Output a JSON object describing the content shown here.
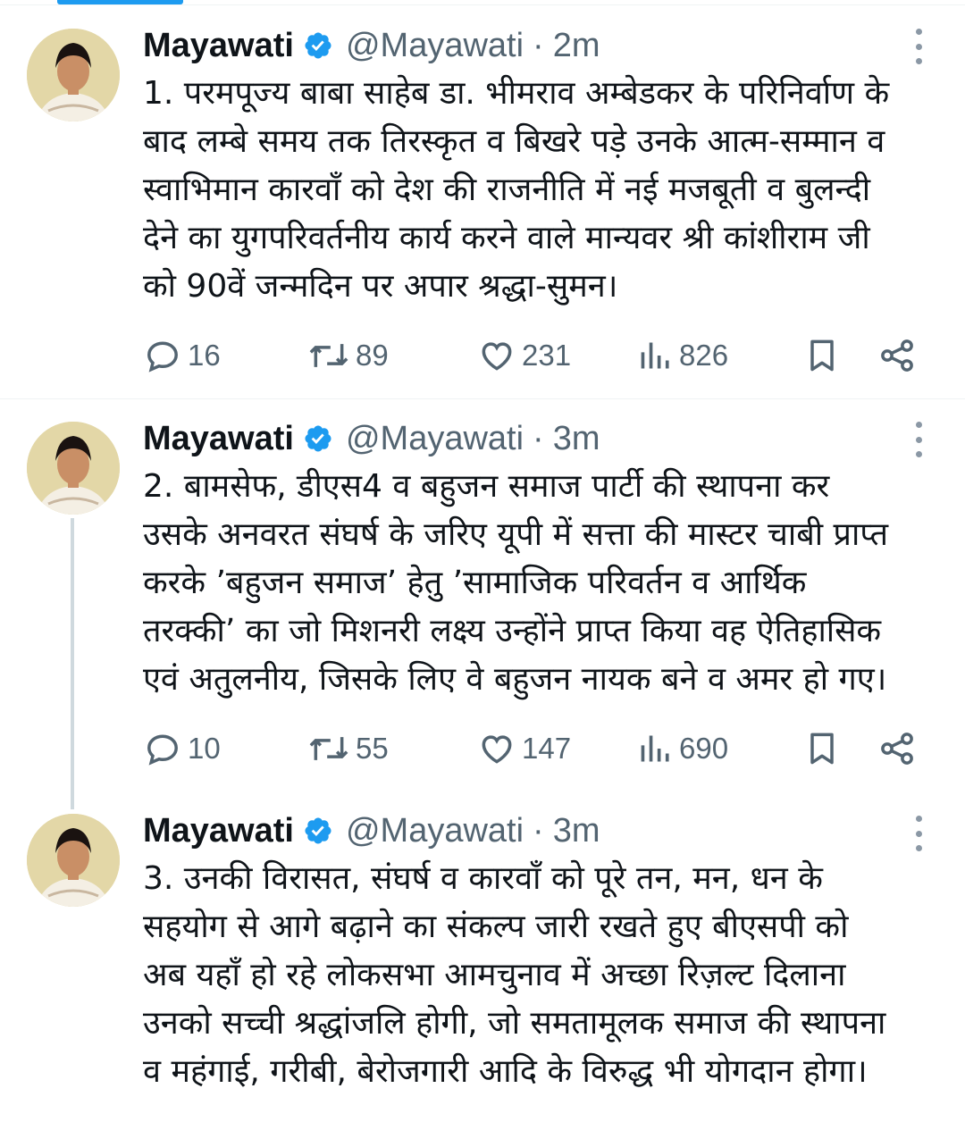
{
  "tweets": [
    {
      "author": {
        "name": "Mayawati",
        "handle": "@Mayawati",
        "verified": true
      },
      "time": "2m",
      "text": "1. परमपूज्य बाबा साहेब डा. भीमराव अम्बेडकर के परिनिर्वाण के\nबाद लम्बे समय तक तिरस्कृत व बिखरे पड़े उनके आत्म-सम्मान व\nस्वाभिमान कारवाँ को देश की राजनीति में नई मजबूती व बुलन्दी\nदेने का युगपरिवर्तनीय कार्य करने वाले मान्यवर श्री कांशीराम जी\nको 90वें जन्मदिन पर अपार श्रद्धा-सुमन।",
      "stats": {
        "replies": "16",
        "reposts": "89",
        "likes": "231",
        "views": "826"
      }
    },
    {
      "author": {
        "name": "Mayawati",
        "handle": "@Mayawati",
        "verified": true
      },
      "time": "3m",
      "text": "2. बामसेफ, डीएस4 व बहुजन समाज पार्टी की स्थापना कर\nउसके अनवरत संघर्ष के जरिए यूपी में सत्ता की मास्टर चाबी प्राप्त\nकरके ’बहुजन समाज’ हेतु ’सामाजिक परिवर्तन व आर्थिक\nतरक्की’ का जो मिशनरी लक्ष्य उन्होंने प्राप्त किया वह ऐतिहासिक\nएवं अतुलनीय, जिसके लिए वे बहुजन नायक बने व अमर हो गए।",
      "stats": {
        "replies": "10",
        "reposts": "55",
        "likes": "147",
        "views": "690"
      }
    },
    {
      "author": {
        "name": "Mayawati",
        "handle": "@Mayawati",
        "verified": true
      },
      "time": "3m",
      "text": "3. उनकी विरासत, संघर्ष व कारवाँ को पूरे तन, मन, धन के\nसहयोग से आगे बढ़ाने का संकल्प जारी रखते हुए बीएसपी को\nअब यहाँ हो रहे लोकसभा आमचुनाव में अच्छा रिज़ल्ट दिलाना\nउनको सच्ची श्रद्धांजलि होगी, जो समतामूलक समाज की स्थापना\nव महंगाई, गरीबी, बेरोजगारी आदि के विरुद्ध भी योगदान होगा।"
    }
  ],
  "colors": {
    "accent": "#1d9bf0",
    "text": "#0f1419",
    "muted": "#536471",
    "divider": "#eff3f4"
  },
  "icons": [
    "reply-icon",
    "repost-icon",
    "like-icon",
    "views-icon",
    "bookmark-icon",
    "share-icon",
    "verified-badge-icon",
    "more-options-icon"
  ]
}
